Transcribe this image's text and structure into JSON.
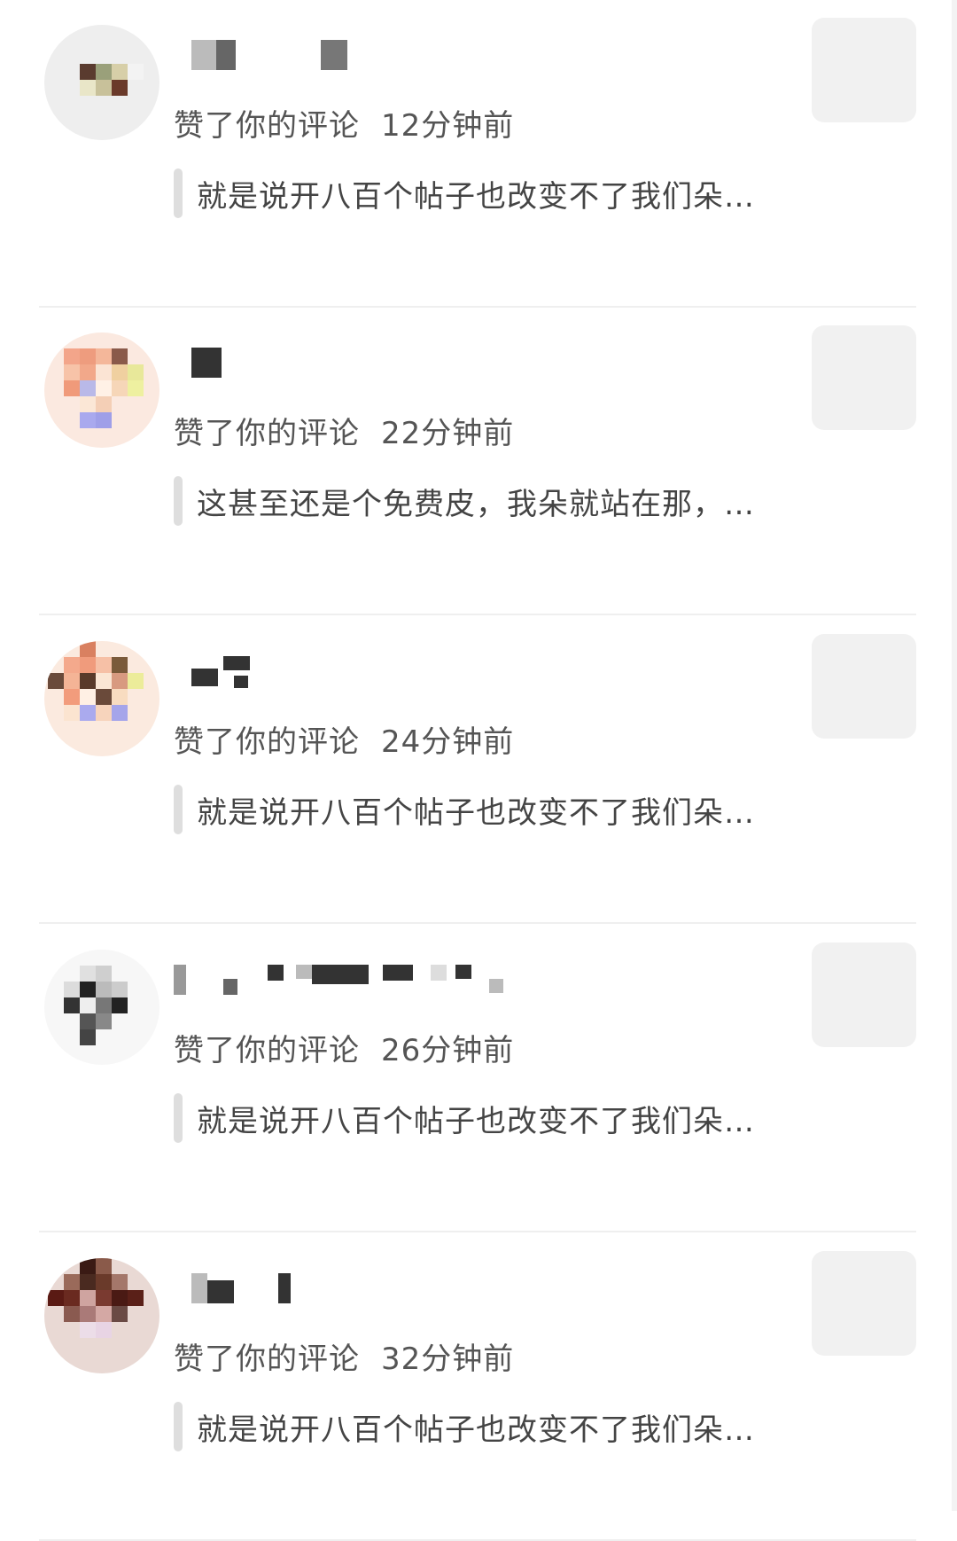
{
  "notifications": [
    {
      "action": "赞了你的评论",
      "time": "12分钟前",
      "comment": "就是说开八百个帖子也改变不了我们朵…"
    },
    {
      "action": "赞了你的评论",
      "time": "22分钟前",
      "comment": "这甚至还是个免费皮，我朵就站在那，…"
    },
    {
      "action": "赞了你的评论",
      "time": "24分钟前",
      "comment": "就是说开八百个帖子也改变不了我们朵…"
    },
    {
      "action": "赞了你的评论",
      "time": "26分钟前",
      "comment": "就是说开八百个帖子也改变不了我们朵…"
    },
    {
      "action": "赞了你的评论",
      "time": "32分钟前",
      "comment": "就是说开八百个帖子也改变不了我们朵…"
    }
  ],
  "colors": {
    "divider": "#efefef",
    "thumb_placeholder": "#f1f1f1",
    "quote_bar": "#dedede"
  }
}
